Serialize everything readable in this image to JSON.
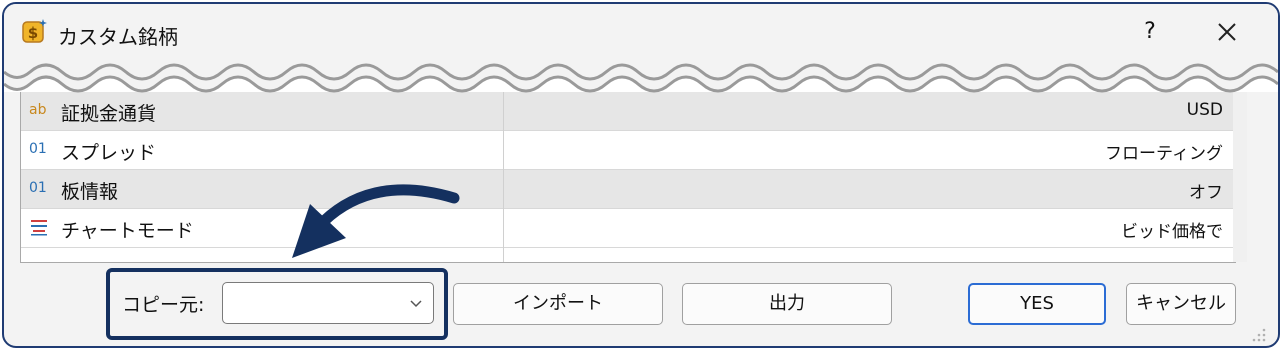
{
  "window": {
    "title": "カスタム銘柄",
    "help": "?"
  },
  "properties": [
    {
      "icon": "ab",
      "label": "証拠金通貨",
      "value": "USD"
    },
    {
      "icon": "01",
      "label": "スプレッド",
      "value": "フローティング"
    },
    {
      "icon": "01",
      "label": "板情報",
      "value": "オフ"
    },
    {
      "icon": "chart-mode-icon",
      "label": "チャートモード",
      "value": "ビッド価格で"
    }
  ],
  "footer": {
    "copy_label": "コピー元:",
    "copy_value": "",
    "import_label": "インポート",
    "export_label": "出力",
    "yes_label": "YES",
    "cancel_label": "キャンセル"
  },
  "colors": {
    "accent": "#14305f",
    "primary_border": "#2b6cd4",
    "icon_ab": "#c8881e",
    "icon_01": "#2a6fb3"
  }
}
